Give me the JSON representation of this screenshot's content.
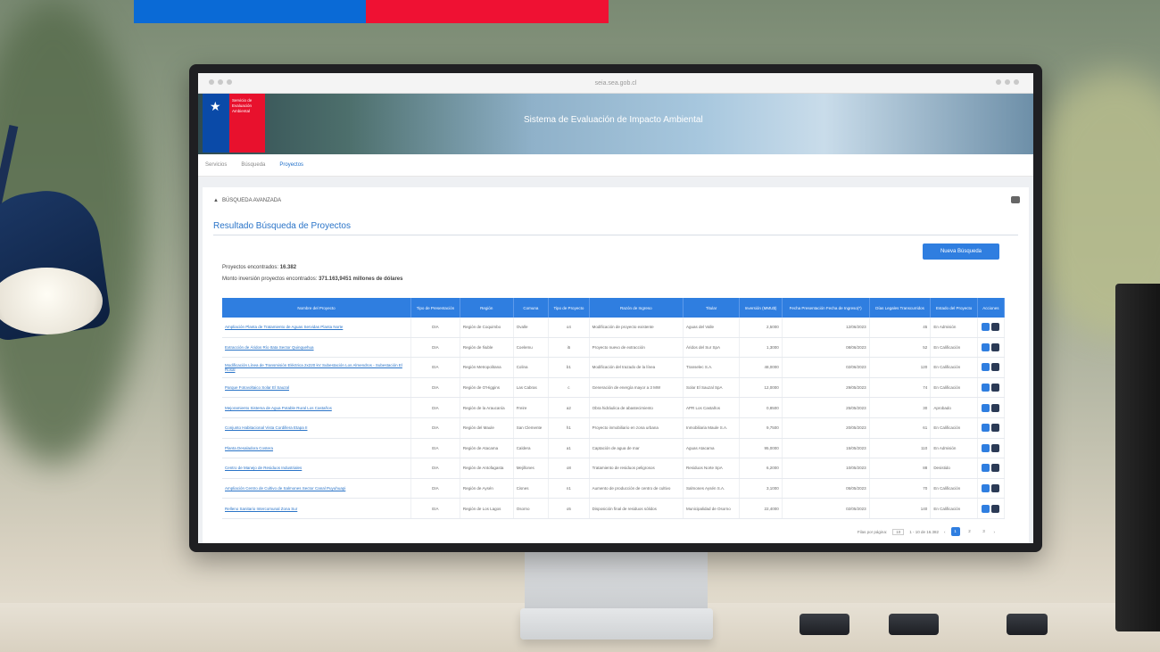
{
  "app": {
    "banner_title": "Sistema de Evaluación de Impacto Ambiental",
    "logo_text": "Servicio de Evaluación Ambiental",
    "url": "seia.sea.gob.cl"
  },
  "nav": {
    "items": [
      {
        "label": "Servicios"
      },
      {
        "label": "Búsqueda"
      },
      {
        "label": "Proyectos"
      }
    ]
  },
  "breadcrumb": {
    "label": "BÚSQUEDA AVANZADA"
  },
  "page": {
    "title": "Resultado Búsqueda de Proyectos",
    "new_search_label": "Nueva Búsqueda",
    "projects_found_label": "Proyectos encontrados:",
    "projects_found_value": "16.382",
    "investment_label": "Monto inversión proyectos encontrados:",
    "investment_value": "371.163,9451 millones de dólares"
  },
  "table": {
    "headers": [
      "Nombre del Proyecto",
      "Tipo de Presentación",
      "Región",
      "Comuna",
      "Tipo de Proyecto",
      "Razón de Ingreso",
      "Titular",
      "Inversión (MMU$)",
      "Fecha Presentación Fecha de Ingreso(*)",
      "Días Legales Transcurridos",
      "Estado del Proyecto",
      "Acciones"
    ],
    "rows": [
      {
        "name": "Ampliación Planta de Tratamiento de Aguas Servidas Planta Norte",
        "tipo": "DIA",
        "region": "Región de Coquimbo",
        "comuna": "Ovalle",
        "tp": "o4",
        "razon": "Modificación de proyecto existente",
        "titular": "Aguas del Valle",
        "inv": "2,5000",
        "fecha": "12/06/2023",
        "dias": "45",
        "estado": "En Admisión"
      },
      {
        "name": "Extracción de Áridos Río Itata Sector Quinquehua",
        "tipo": "DIA",
        "region": "Región de Ñuble",
        "comuna": "Coelemu",
        "tp": "i5",
        "razon": "Proyecto nuevo de extracción",
        "titular": "Áridos del Sur SpA",
        "inv": "1,3000",
        "fecha": "08/06/2023",
        "dias": "52",
        "estado": "En Calificación"
      },
      {
        "name": "Modificación Línea de Transmisión Eléctrica 2x220 kV Subestación Los Almendros - Subestación El Rosal",
        "tipo": "EIA",
        "region": "Región Metropolitana",
        "comuna": "Colina",
        "tp": "b1",
        "razon": "Modificación del trazado de la línea",
        "titular": "Transelec S.A.",
        "inv": "48,0000",
        "fecha": "02/06/2023",
        "dias": "120",
        "estado": "En Calificación"
      },
      {
        "name": "Parque Fotovoltaico Solar El Sauzal",
        "tipo": "DIA",
        "region": "Región de O'Higgins",
        "comuna": "Las Cabras",
        "tp": "c",
        "razon": "Generación de energía mayor a 3 MW",
        "titular": "Solar El Sauzal SpA",
        "inv": "12,0000",
        "fecha": "29/05/2023",
        "dias": "74",
        "estado": "En Calificación"
      },
      {
        "name": "Mejoramiento Sistema de Agua Potable Rural Los Castaños",
        "tipo": "DIA",
        "region": "Región de la Araucanía",
        "comuna": "Freire",
        "tp": "a2",
        "razon": "Obra hidráulica de abastecimiento",
        "titular": "APR Los Castaños",
        "inv": "0,8500",
        "fecha": "25/05/2023",
        "dias": "30",
        "estado": "Aprobado"
      },
      {
        "name": "Conjunto Habitacional Vista Cordillera Etapa II",
        "tipo": "DIA",
        "region": "Región del Maule",
        "comuna": "San Clemente",
        "tp": "h1",
        "razon": "Proyecto inmobiliario en zona urbana",
        "titular": "Inmobiliaria Maule S.A.",
        "inv": "9,7500",
        "fecha": "20/05/2023",
        "dias": "61",
        "estado": "En Calificación"
      },
      {
        "name": "Planta Desaladora Costera",
        "tipo": "EIA",
        "region": "Región de Atacama",
        "comuna": "Caldera",
        "tp": "a1",
        "razon": "Captación de agua de mar",
        "titular": "Aguas Atacama",
        "inv": "95,0000",
        "fecha": "15/05/2023",
        "dias": "110",
        "estado": "En Admisión"
      },
      {
        "name": "Centro de Manejo de Residuos Industriales",
        "tipo": "DIA",
        "region": "Región de Antofagasta",
        "comuna": "Mejillones",
        "tp": "o8",
        "razon": "Tratamiento de residuos peligrosos",
        "titular": "Residuos Norte SpA",
        "inv": "6,2000",
        "fecha": "10/05/2023",
        "dias": "88",
        "estado": "Desistido"
      },
      {
        "name": "Ampliación Centro de Cultivo de Salmones Sector Canal Puyuhuapi",
        "tipo": "DIA",
        "region": "Región de Aysén",
        "comuna": "Cisnes",
        "tp": "n1",
        "razon": "Aumento de producción de centro de cultivo",
        "titular": "Salmones Aysén S.A.",
        "inv": "3,1000",
        "fecha": "05/05/2023",
        "dias": "70",
        "estado": "En Calificación"
      },
      {
        "name": "Relleno Sanitario Intercomunal Zona Sur",
        "tipo": "EIA",
        "region": "Región de Los Lagos",
        "comuna": "Osorno",
        "tp": "o5",
        "razon": "Disposición final de residuos sólidos",
        "titular": "Municipalidad de Osorno",
        "inv": "22,4000",
        "fecha": "02/05/2023",
        "dias": "140",
        "estado": "En Calificación"
      }
    ]
  },
  "pager": {
    "rows_label": "Filas por página:",
    "rows_value": "10",
    "range": "1 - 10 de 16.382",
    "pages": [
      "1",
      "2",
      "3"
    ]
  },
  "colors": {
    "accent": "#2f7ee0",
    "flag_blue": "#0a6ad6",
    "flag_red": "#ef1133"
  }
}
